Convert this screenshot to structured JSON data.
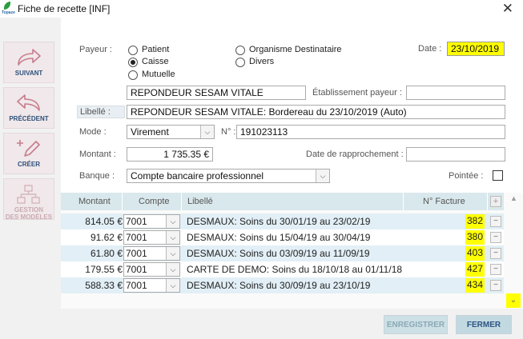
{
  "window": {
    "title": "Fiche de recette [INF]",
    "app_logo_text": "Topaze"
  },
  "sidebar": {
    "items": [
      {
        "label": "SUIVANT",
        "enabled": true
      },
      {
        "label": "PRÉCÉDENT",
        "enabled": true
      },
      {
        "label": "CRÉER",
        "enabled": true
      },
      {
        "label": "GESTION\nDES MODÈLES",
        "enabled": false
      }
    ]
  },
  "form": {
    "payeur_label": "Payeur :",
    "payeur_options": [
      "Patient",
      "Caisse",
      "Mutuelle",
      "Organisme Destinataire",
      "Divers"
    ],
    "payeur_selected": "Caisse",
    "payeur_name": "REPONDEUR SESAM VITALE",
    "etablissement_label": "Établissement payeur :",
    "etablissement_value": "",
    "date_label": "Date :",
    "date_value": "23/10/2019",
    "libelle_label": "Libellé :",
    "libelle_value": "REPONDEUR SESAM VITALE: Bordereau du 23/10/2019 (Auto)",
    "mode_label": "Mode :",
    "mode_value": "Virement",
    "numero_label": "N° :",
    "numero_value": "191023113",
    "montant_label": "Montant :",
    "montant_value": "1 735.35 €",
    "rapprochement_label": "Date de rapprochement :",
    "rapprochement_value": "",
    "banque_label": "Banque :",
    "banque_value": "Compte bancaire professionnel",
    "pointee_label": "Pointée :",
    "pointee_checked": false
  },
  "table": {
    "headers": {
      "montant": "Montant",
      "compte": "Compte",
      "libelle": "Libellé",
      "facture": "N° Facture"
    },
    "rows": [
      {
        "montant": "814.05 €",
        "compte": "7001",
        "libelle": "DESMAUX: Soins du 30/01/19 au 23/02/19",
        "facture": "382"
      },
      {
        "montant": "91.62 €",
        "compte": "7001",
        "libelle": "DESMAUX: Soins du 15/04/19 au 30/04/19",
        "facture": "380"
      },
      {
        "montant": "61.80 €",
        "compte": "7001",
        "libelle": "DESMAUX: Soins du 03/09/19 au 11/09/19",
        "facture": "403"
      },
      {
        "montant": "179.55 €",
        "compte": "7001",
        "libelle": "CARTE DE DEMO: Soins du 18/10/18 au 01/11/18",
        "facture": "427"
      },
      {
        "montant": "588.33 €",
        "compte": "7001",
        "libelle": "DESMAUX: Soins du 30/09/19 au 23/10/19",
        "facture": "434"
      }
    ]
  },
  "buttons": {
    "enregistrer": "ENREGISTRER",
    "fermer": "FERMER"
  },
  "colors": {
    "highlight": "#ffff00",
    "row_alt": "#e2eff6",
    "header_bg": "#d9e8ec",
    "sidebar_btn": "#f0e8ea",
    "accent_text": "#2d4f7a"
  }
}
